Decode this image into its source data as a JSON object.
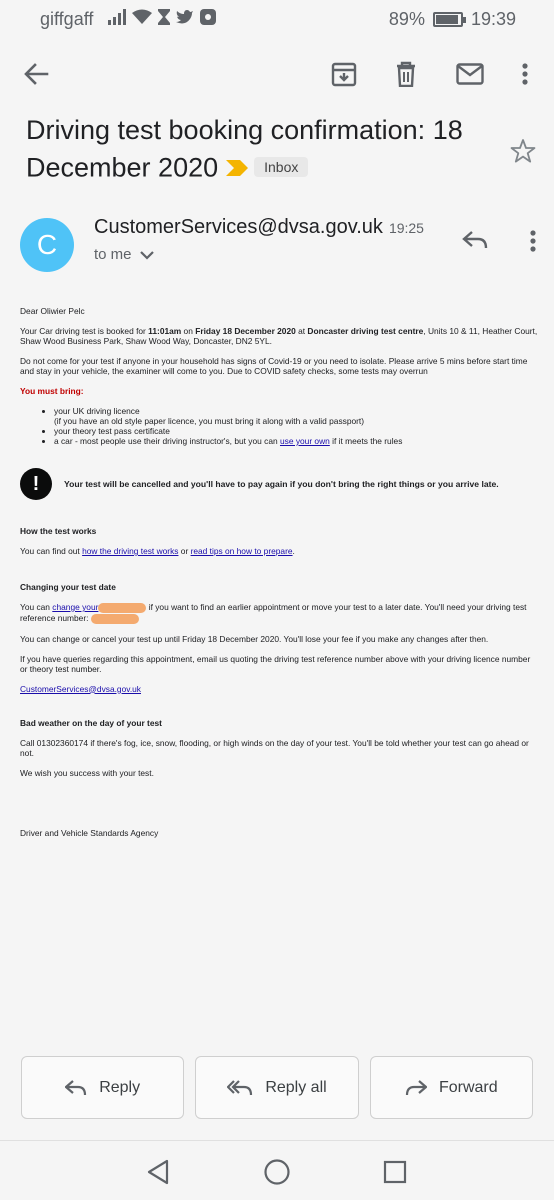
{
  "status_bar": {
    "carrier": "giffgaff",
    "battery": "89%",
    "time": "19:39",
    "icons": [
      "signal-icon",
      "wifi-icon",
      "hourglass-icon",
      "twitter-icon",
      "app-icon"
    ]
  },
  "app_bar": {
    "icons": [
      "back-arrow-icon",
      "archive-icon",
      "delete-icon",
      "mail-icon",
      "more-vert-icon"
    ]
  },
  "message": {
    "subject": "Driving test booking confirmation: 18 December 2020",
    "label": "Inbox",
    "sender_initial": "C",
    "sender": "CustomerServices@dvsa.gov.uk",
    "time": "19:25",
    "to": "to me"
  },
  "email": {
    "greeting": "Dear Oliwier Pelc",
    "p1_a": "Your Car driving test is booked for ",
    "p1_time": "11:01am",
    "p1_b": " on ",
    "p1_date": "Friday 18 December 2020",
    "p1_c": " at ",
    "p1_centre": "Doncaster driving test centre",
    "p1_d": ", Units 10 & 11, Heather Court, Shaw Wood Business Park, Shaw Wood Way, Doncaster, DN2 5YL.",
    "p2": "Do not come for your test if anyone in your household has signs of Covid-19 or you need to isolate. Please arrive 5 mins before start time and stay in your vehicle, the examiner will come to you. Due to COVID safety checks, some tests may overrun",
    "must_bring": "You must bring:",
    "bring_1": "your UK driving licence",
    "bring_1_note": "(if you have an old style paper licence, you must bring it along with a valid passport)",
    "bring_2": "your theory test pass certificate",
    "bring_3a": "a car - most people use their driving instructor's, but you can ",
    "bring_3_link": "use your own",
    "bring_3b": " if it meets the rules",
    "warning": "Your test will be cancelled and you'll have to pay again if you don't bring the right things or you arrive late.",
    "how_heading": "How the test works",
    "how_a": "You can find out ",
    "how_link1": "how the driving test works",
    "how_b": " or ",
    "how_link2": "read tips on how to prepare",
    "how_c": ".",
    "change_heading": "Changing your test date",
    "change_a": "You can ",
    "change_link": "change your",
    "change_b": " if you want to find an earlier appointment or move your test to a later date. You'll need your driving test reference number: ",
    "change_p2": "You can change or cancel your test up until Friday 18 December 2020. You'll lose your fee if you make any changes after then.",
    "change_p3": "If you have queries regarding this appointment, email us quoting the driving test reference number above with your driving licence number or theory test number.",
    "email_link": "CustomerServices@dvsa.gov.uk",
    "weather_heading": "Bad weather on the day of your test",
    "weather_p": "Call 01302360174 if there's fog, ice, snow, flooding, or high winds on the day of your test. You'll be told whether your test can go ahead or not.",
    "wish": "We wish you success with your test.",
    "signature": "Driver and Vehicle Standards Agency"
  },
  "actions": {
    "reply": "Reply",
    "reply_all": "Reply all",
    "forward": "Forward"
  },
  "nav": {
    "icons": [
      "back-triangle-icon",
      "home-circle-icon",
      "recents-square-icon"
    ]
  },
  "colors": {
    "avatar": "#4fc3f7",
    "important_marker": "#f4b400",
    "must_bring": "#c00000",
    "link": "#1a0dab"
  }
}
